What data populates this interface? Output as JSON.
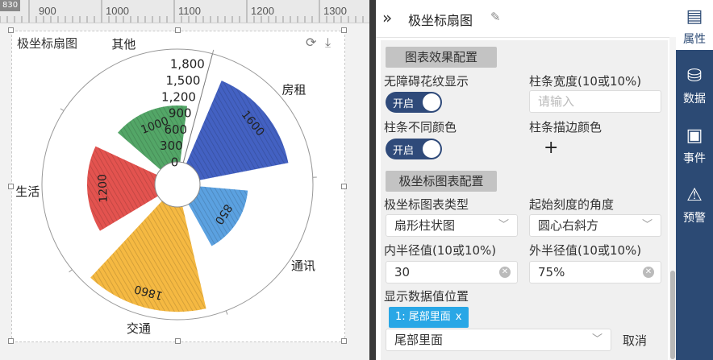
{
  "ruler": {
    "tag": "830",
    "ticks": [
      "900",
      "1000",
      "1100",
      "1200",
      "1300"
    ]
  },
  "widget": {
    "title": "极坐标扇图",
    "refresh_icon": "refresh-icon",
    "download_icon": "download-icon"
  },
  "chart_data": {
    "type": "bar",
    "subtype": "polar-sector",
    "title": "极坐标扇图",
    "categories": [
      "房租",
      "通讯",
      "交通",
      "生活",
      "其他"
    ],
    "values": [
      1600,
      850,
      1860,
      1200,
      1000
    ],
    "colors": [
      "#4361c2",
      "#5ba1e0",
      "#f5b942",
      "#e3534f",
      "#53a667"
    ],
    "radial_ticks": [
      "0",
      "300",
      "600",
      "900",
      "1,200",
      "1,500",
      "1,800"
    ],
    "rmax": 2000,
    "inner_radius": "30",
    "outer_radius": "75%",
    "label_position": "尾部里面"
  },
  "panel": {
    "title": "极坐标扇图",
    "section1": "图表效果配置",
    "barrier_free_label": "无障碍花纹显示",
    "barrier_free_toggle": "开启",
    "bar_width_label": "柱条宽度(10或10%)",
    "bar_width_placeholder": "请输入",
    "diff_color_label": "柱条不同颜色",
    "diff_color_toggle": "开启",
    "stroke_color_label": "柱条描边颜色",
    "section2": "极坐标图表配置",
    "polar_type_label": "极坐标图表类型",
    "polar_type_value": "扇形柱状图",
    "start_angle_label": "起始刻度的角度",
    "start_angle_value": "圆心右斜方",
    "inner_radius_label": "内半径值(10或10%)",
    "inner_radius_value": "30",
    "outer_radius_label": "外半径值(10或10%)",
    "outer_radius_value": "75%",
    "label_pos_label": "显示数据值位置",
    "tag_text": "1: 尾部里面",
    "label_pos_value": "尾部里面",
    "cancel": "取消"
  },
  "nav": [
    {
      "label": "属性",
      "icon": "properties-icon"
    },
    {
      "label": "数据",
      "icon": "database-icon"
    },
    {
      "label": "事件",
      "icon": "event-icon"
    },
    {
      "label": "预警",
      "icon": "alarm-icon"
    }
  ]
}
